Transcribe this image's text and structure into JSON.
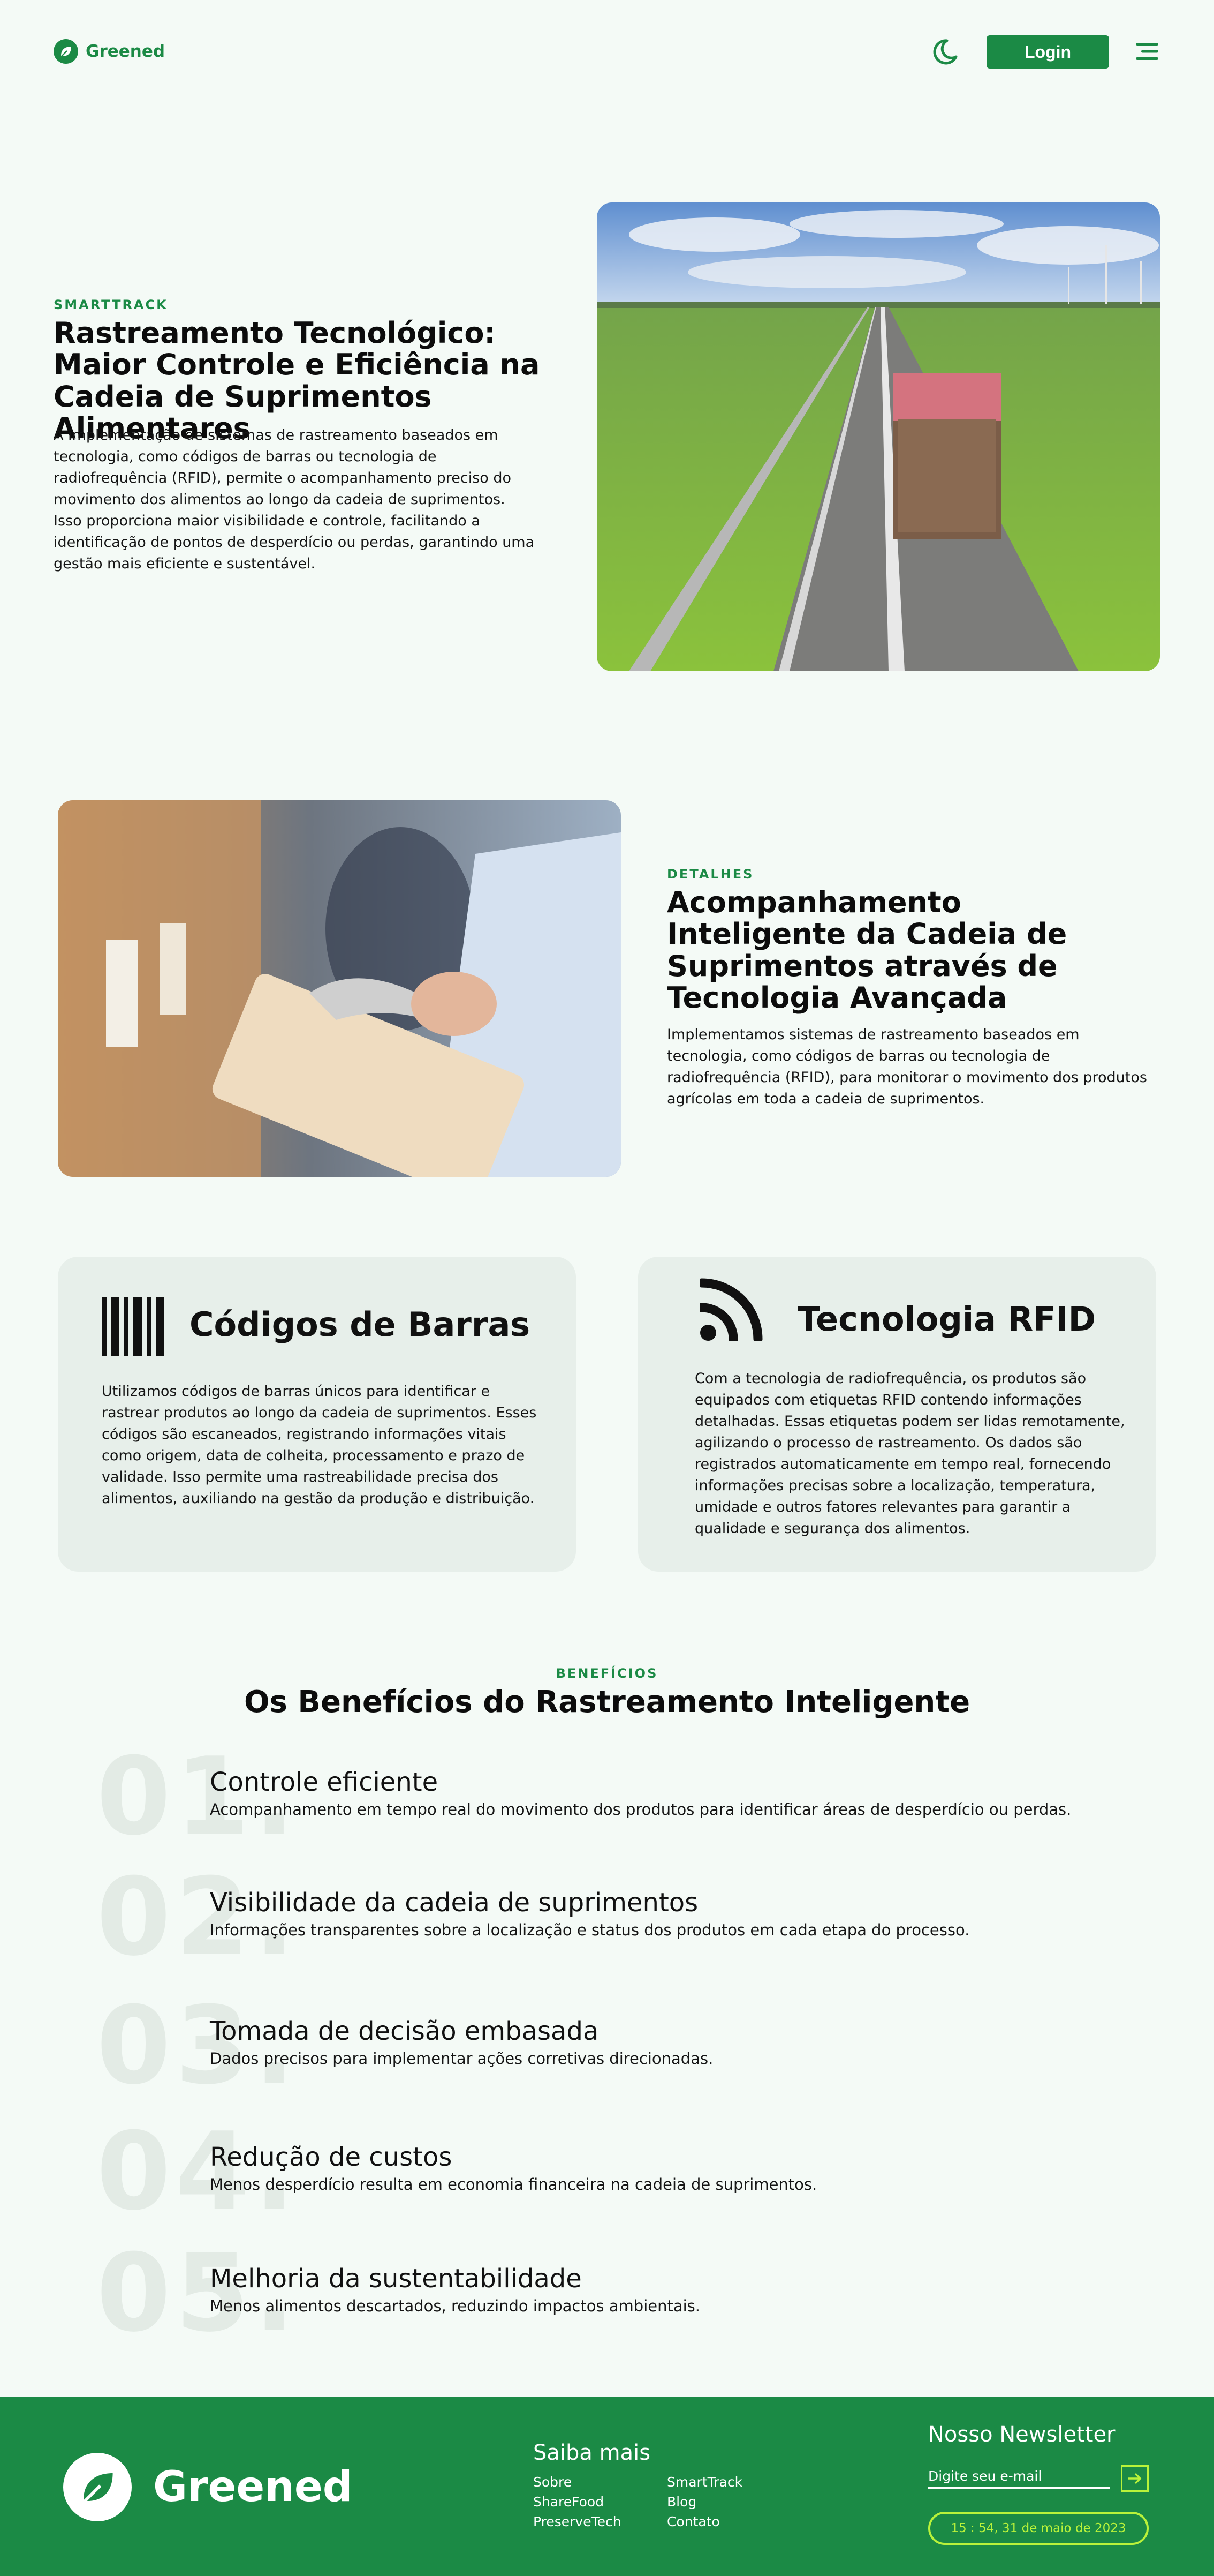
{
  "header": {
    "brand": "Greened",
    "login_label": "Login"
  },
  "section1": {
    "kicker": "SMARTTRACK",
    "title": "Rastreamento Tecnológico: Maior Controle e Eficiência na Cadeia de Suprimentos Alimentares",
    "text": "A implementação de sistemas de rastreamento baseados em tecnologia, como códigos de barras ou tecnologia de radiofrequência (RFID), permite o acompanhamento preciso do movimento dos alimentos ao longo da cadeia de suprimentos. Isso proporciona maior visibilidade e controle, facilitando a identificação de pontos de desperdício ou perdas, garantindo uma gestão mais eficiente e sustentável."
  },
  "section2": {
    "kicker": "DETALHES",
    "title": "Acompanhamento Inteligente da Cadeia de Suprimentos através de Tecnologia Avançada",
    "text": "Implementamos sistemas de rastreamento baseados em tecnologia, como códigos de barras ou tecnologia de radiofrequência (RFID), para monitorar o movimento dos produtos agrícolas em toda a cadeia de suprimentos."
  },
  "cards": [
    {
      "title": "Códigos de Barras",
      "text": "Utilizamos códigos de barras únicos para identificar e rastrear produtos ao longo da cadeia de suprimentos. Esses códigos são escaneados, registrando informações vitais como origem, data de colheita, processamento e prazo de validade. Isso permite uma rastreabilidade precisa dos alimentos, auxiliando na gestão da produção e distribuição."
    },
    {
      "title": "Tecnologia RFID",
      "text": "Com a tecnologia de radiofrequência, os produtos são equipados com etiquetas RFID contendo informações detalhadas. Essas etiquetas podem ser lidas remotamente, agilizando o processo de rastreamento. Os dados são registrados automaticamente em tempo real, fornecendo informações precisas sobre a localização, temperatura, umidade e outros fatores relevantes para garantir a qualidade e segurança dos alimentos."
    }
  ],
  "benefits": {
    "kicker": "BENEFÍCIOS",
    "title": "Os Benefícios do Rastreamento Inteligente",
    "items": [
      {
        "num": "01.",
        "title": "Controle eficiente",
        "text": "Acompanhamento em tempo real do movimento dos produtos para identificar áreas de desperdício ou perdas."
      },
      {
        "num": "02.",
        "title": "Visibilidade da cadeia de suprimentos",
        "text": "Informações transparentes sobre a localização e status dos produtos em cada etapa do processo."
      },
      {
        "num": "03.",
        "title": "Tomada de decisão embasada",
        "text": "Dados precisos para implementar ações corretivas direcionadas."
      },
      {
        "num": "04.",
        "title": "Redução de custos",
        "text": "Menos desperdício resulta em economia financeira na cadeia de suprimentos."
      },
      {
        "num": "05.",
        "title": "Melhoria da sustentabilidade",
        "text": "Menos alimentos descartados, reduzindo impactos ambientais."
      }
    ]
  },
  "footer": {
    "brand": "Greened",
    "links_title": "Saiba mais",
    "links": [
      "Sobre",
      "SmartTrack",
      "ShareFood",
      "Blog",
      "PreserveTech",
      "Contato"
    ],
    "newsletter_title": "Nosso Newsletter",
    "newsletter_placeholder": "Digite seu e-mail",
    "datetime": "15 : 54, 31 de maio de 2023"
  },
  "colors": {
    "brand_green": "#1b8a45",
    "background": "#f4faf6",
    "card_bg": "#e7efea",
    "lime_accent": "#b9f23a"
  },
  "icons": [
    "leaf-icon",
    "moon-icon",
    "menu-icon",
    "barcode-icon",
    "rss-icon",
    "arrow-right-icon"
  ]
}
